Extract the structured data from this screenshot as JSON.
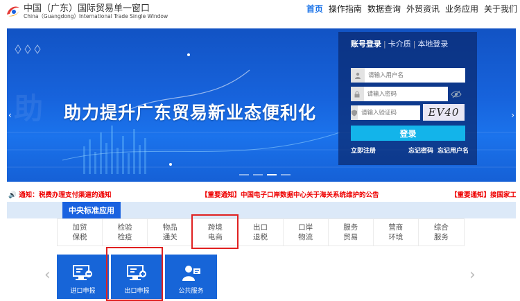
{
  "header": {
    "logo_cn": "中国（广东）国际贸易单一窗口",
    "logo_en": "China（Guangdong）International Trade Single Window",
    "nav": [
      "首页",
      "操作指南",
      "数据查询",
      "外贸资讯",
      "业务应用",
      "关于我们"
    ]
  },
  "banner": {
    "headline": "助力提升广东贸易新业态便利化",
    "prev": "‹",
    "next": "›"
  },
  "login": {
    "tabs": [
      "账号登录",
      "卡介质",
      "本地登录"
    ],
    "username_placeholder": "请输入用户名",
    "password_placeholder": "请输入密码",
    "captcha_placeholder": "请输入验证码",
    "captcha_text": "EV40",
    "submit": "登录",
    "register": "立即注册",
    "forgot_password": "忘记密码",
    "forgot_username": "忘记用户名"
  },
  "notice": {
    "label": "通知：",
    "items": [
      "税费办理支付渠道的通知",
      "【重要通知】中国电子口岸数据中心关于海关系统维护的公告",
      "【重要通知】接国家工"
    ]
  },
  "category": {
    "active_tab": "中央标准应用",
    "items": [
      [
        "加贸",
        "保税"
      ],
      [
        "检验",
        "检疫"
      ],
      [
        "物品",
        "通关"
      ],
      [
        "跨境",
        "电商"
      ],
      [
        "出口",
        "退税"
      ],
      [
        "口岸",
        "物流"
      ],
      [
        "服务",
        "贸易"
      ],
      [
        "营商",
        "环境"
      ],
      [
        "综合",
        "服务"
      ]
    ]
  },
  "tiles": [
    "进口申报",
    "出口申报",
    "公共服务"
  ],
  "colors": {
    "primary": "#1a62e0",
    "highlight": "#e02020",
    "login_button": "#13b4ea"
  }
}
